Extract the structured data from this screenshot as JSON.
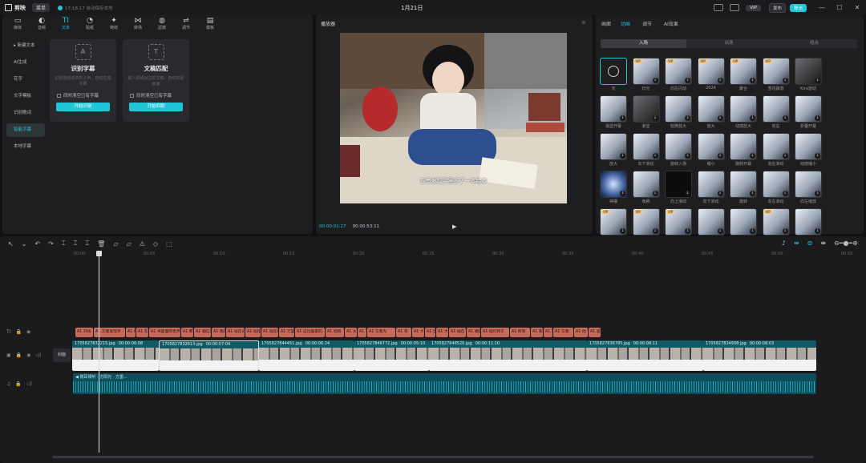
{
  "titlebar": {
    "app_name": "剪映",
    "menu": "菜单",
    "autosave": "17:18:17 自动保存本地",
    "title": "1月21日",
    "vip": "VIP",
    "publish": "发布",
    "export": "导出",
    "min": "—",
    "max": "☐",
    "close": "✕"
  },
  "toolbar": {
    "items": [
      {
        "icon": "▭",
        "label": "媒体"
      },
      {
        "icon": "◐",
        "label": "音频"
      },
      {
        "icon": "TI",
        "label": "文本"
      },
      {
        "icon": "◔",
        "label": "贴纸"
      },
      {
        "icon": "✦",
        "label": "特效"
      },
      {
        "icon": "⋈",
        "label": "转场"
      },
      {
        "icon": "◍",
        "label": "滤镜"
      },
      {
        "icon": "⇌",
        "label": "调节"
      },
      {
        "icon": "▤",
        "label": "模板"
      }
    ]
  },
  "text_sidebar": {
    "items": [
      "▸ 新建文本",
      "AI生成",
      "花字",
      "文字模板",
      "识别歌词",
      "智能字幕",
      "本地字幕"
    ]
  },
  "cards": [
    {
      "icon": "A",
      "title": "识别字幕",
      "desc": "识别音视频中的人声，自动生成字幕",
      "check": "同时清空已有字幕",
      "button": "开始识别"
    },
    {
      "icon": "T",
      "title": "文稿匹配",
      "desc": "输入视频对应的文稿，自动匹配画面",
      "check": "同时清空已有字幕",
      "button": "开始匹配"
    }
  ],
  "player": {
    "title": "播放器",
    "menu": "≡",
    "subtitle": "方墨发现手里多了一本绘本",
    "time_current": "00:00:01:27",
    "time_total": "00:00:53:11",
    "play": "▶"
  },
  "effects": {
    "tabs": [
      "画面",
      "动画",
      "调节",
      "AI效果"
    ],
    "active_tab": "动画",
    "segments": [
      "入场",
      "出场",
      "组合"
    ],
    "active_segment": "入场",
    "items": [
      {
        "label": "无",
        "type": "none",
        "vip": false
      },
      {
        "label": "扫光",
        "type": "thumb",
        "vip": true
      },
      {
        "label": "向左闪动",
        "type": "thumb",
        "vip": true
      },
      {
        "label": "2024",
        "type": "thumb",
        "vip": true
      },
      {
        "label": "聚合",
        "type": "thumb",
        "vip": true
      },
      {
        "label": "雪花飘落",
        "type": "thumb",
        "vip": true
      },
      {
        "label": "Kira游动",
        "type": "dark",
        "vip": false
      },
      {
        "label": "渐显开幕",
        "type": "thumb",
        "vip": false
      },
      {
        "label": "渐显",
        "type": "dark",
        "vip": false
      },
      {
        "label": "轻微放大",
        "type": "thumb",
        "vip": false
      },
      {
        "label": "放大",
        "type": "thumb",
        "vip": false
      },
      {
        "label": "动感放大",
        "type": "thumb",
        "vip": false
      },
      {
        "label": "向右",
        "type": "thumb",
        "vip": false
      },
      {
        "label": "折叠开幕",
        "type": "thumb",
        "vip": false
      },
      {
        "label": "放大",
        "type": "thumb",
        "vip": false
      },
      {
        "label": "向下滑动",
        "type": "thumb",
        "vip": false
      },
      {
        "label": "旋转入场",
        "type": "thumb",
        "vip": false
      },
      {
        "label": "缩小",
        "type": "thumb",
        "vip": false
      },
      {
        "label": "旋转开幕",
        "type": "thumb",
        "vip": false
      },
      {
        "label": "向右滑动",
        "type": "thumb",
        "vip": false
      },
      {
        "label": "动感缩小",
        "type": "thumb",
        "vip": false
      },
      {
        "label": "钟摆",
        "type": "blue",
        "vip": false
      },
      {
        "label": "雨刷",
        "type": "thumb",
        "vip": false
      },
      {
        "label": "向上滑动",
        "type": "blk",
        "vip": false
      },
      {
        "label": "向下滑动",
        "type": "thumb",
        "vip": false
      },
      {
        "label": "旋转",
        "type": "thumb",
        "vip": false
      },
      {
        "label": "向左滑动",
        "type": "thumb",
        "vip": false
      },
      {
        "label": "向左缩放",
        "type": "thumb",
        "vip": false
      },
      {
        "label": "",
        "type": "thumb",
        "vip": true
      },
      {
        "label": "",
        "type": "thumb",
        "vip": true
      },
      {
        "label": "",
        "type": "thumb",
        "vip": true
      },
      {
        "label": "",
        "type": "thumb",
        "vip": false
      },
      {
        "label": "",
        "type": "thumb",
        "vip": false
      },
      {
        "label": "",
        "type": "thumb",
        "vip": true
      },
      {
        "label": "",
        "type": "thumb",
        "vip": false
      }
    ]
  },
  "timeline": {
    "tools": [
      "↖",
      "⌄",
      "↶",
      "↷",
      "⌶",
      "⌶",
      "⌶",
      "🗑",
      "▱",
      "▱",
      "⚠",
      "◇",
      "⬚"
    ],
    "ruler": [
      "00:00",
      "00:05",
      "00:10",
      "00:15",
      "00:20",
      "00:25",
      "00:30",
      "00:35",
      "00:40",
      "00:45",
      "00:50",
      "00:55"
    ],
    "text_clips": [
      {
        "text": "A1 开始"
      },
      {
        "text": "A1 方墨发现手"
      },
      {
        "text": "A1 他"
      },
      {
        "text": "A1 在"
      },
      {
        "text": "A1 书里面的世界"
      },
      {
        "text": "A1 那头"
      },
      {
        "text": "A1 相信自"
      },
      {
        "text": "A1 我在"
      },
      {
        "text": "A1 站在山顶上"
      },
      {
        "text": "A1 他在"
      },
      {
        "text": "A1 他在他们"
      },
      {
        "text": "A1 万里无"
      },
      {
        "text": "A1 这位画家的"
      },
      {
        "text": "A1 他和"
      },
      {
        "text": "A1 大"
      },
      {
        "text": "A1 有"
      },
      {
        "text": "A1 方墨为"
      },
      {
        "text": "A1 有"
      },
      {
        "text": "A1 大"
      },
      {
        "text": "A1 出"
      },
      {
        "text": "A1 大"
      },
      {
        "text": "A1 她在"
      },
      {
        "text": "A1 相信"
      },
      {
        "text": "A1 他们终于"
      },
      {
        "text": "A1 所有"
      },
      {
        "text": "A1 和"
      },
      {
        "text": "A1 就"
      },
      {
        "text": "A1 方墨"
      },
      {
        "text": "A1 他"
      },
      {
        "text": "A1 画"
      }
    ],
    "video_clips": [
      {
        "name": "1705827832215.jpg",
        "dur": "00:00:06:08"
      },
      {
        "name": "1705827832613.jpg",
        "dur": "00:00:07:04"
      },
      {
        "name": "1705827844451.jpg",
        "dur": "00:00:06:24"
      },
      {
        "name": "1705827846772.jpg",
        "dur": "00:00:05:10"
      },
      {
        "name": "1705827848520.jpg",
        "dur": "00:00:11:10"
      },
      {
        "name": "1705827836785.jpg",
        "dur": "00:00:08:11"
      },
      {
        "name": "1705827834908.jpg",
        "dur": "00:00:08:03"
      }
    ],
    "cover": "封面",
    "audio": "◀ 侧耳倾听 · 方阳光 · 方墨..."
  }
}
